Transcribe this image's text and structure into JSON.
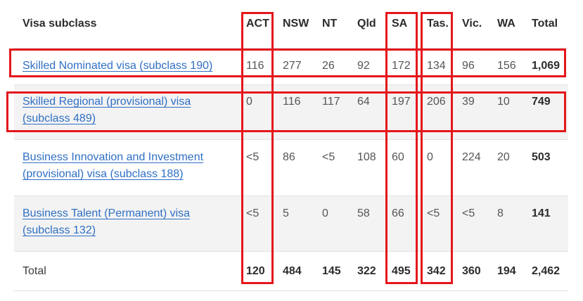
{
  "table": {
    "headers": {
      "visa": "Visa subclass",
      "act": "ACT",
      "nsw": "NSW",
      "nt": "NT",
      "qld": "Qld",
      "sa": "SA",
      "tas": "Tas.",
      "vic": "Vic.",
      "wa": "WA",
      "total": "Total"
    },
    "rows": [
      {
        "visa": "Skilled Nominated visa (subclass 190)",
        "act": "116",
        "nsw": "277",
        "nt": "26",
        "qld": "92",
        "sa": "172",
        "tas": "134",
        "vic": "96",
        "wa": "156",
        "total": "1,069"
      },
      {
        "visa": "Skilled Regional (provisional) visa (subclass 489)",
        "act": "0",
        "nsw": "116",
        "nt": "117",
        "qld": "64",
        "sa": "197",
        "tas": "206",
        "vic": "39",
        "wa": "10",
        "total": "749"
      },
      {
        "visa": "Business Innovation and Investment (provisional) visa (subclass 188)",
        "act": "<5",
        "nsw": "86",
        "nt": "<5",
        "qld": "108",
        "sa": "60",
        "tas": "0",
        "vic": "224",
        "wa": "20",
        "total": "503"
      },
      {
        "visa": "Business Talent (Permanent) visa (subclass 132)",
        "act": "<5",
        "nsw": "5",
        "nt": "0",
        "qld": "58",
        "sa": "66",
        "tas": "<5",
        "vic": "<5",
        "wa": "8",
        "total": "141"
      }
    ],
    "totals": {
      "label": "Total",
      "act": "120",
      "nsw": "484",
      "nt": "145",
      "qld": "322",
      "sa": "495",
      "tas": "342",
      "vic": "360",
      "wa": "194",
      "total": "2,462"
    }
  },
  "highlight_color": "#e4161b",
  "link_color": "#2f6fc4"
}
